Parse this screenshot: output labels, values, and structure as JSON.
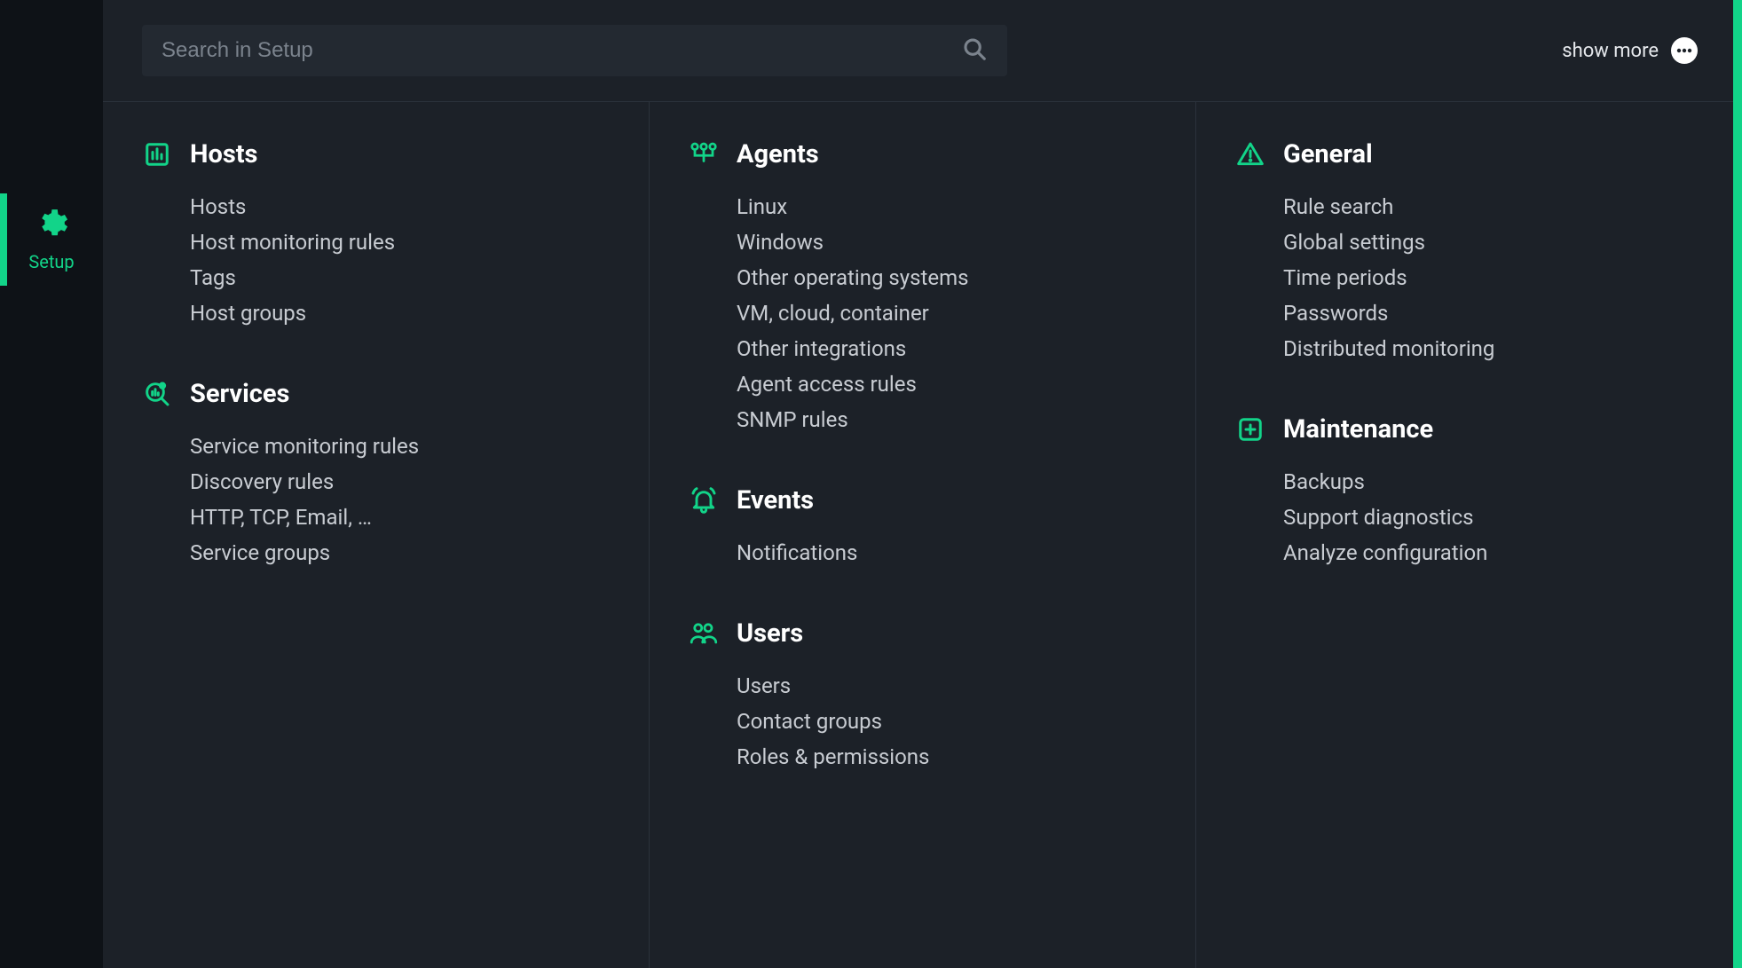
{
  "sidebar": {
    "active_label": "Setup"
  },
  "search": {
    "placeholder": "Search in Setup"
  },
  "show_more_label": "show more",
  "columns": [
    {
      "sections": [
        {
          "icon": "chart-box",
          "title": "Hosts",
          "items": [
            "Hosts",
            "Host monitoring rules",
            "Tags",
            "Host groups"
          ]
        },
        {
          "icon": "magnify-chart",
          "title": "Services",
          "items": [
            "Service monitoring rules",
            "Discovery rules",
            "HTTP, TCP, Email, …",
            "Service groups"
          ]
        }
      ]
    },
    {
      "sections": [
        {
          "icon": "network",
          "title": "Agents",
          "items": [
            "Linux",
            "Windows",
            "Other operating systems",
            "VM, cloud, container",
            "Other integrations",
            "Agent access rules",
            "SNMP rules"
          ]
        },
        {
          "icon": "bell",
          "title": "Events",
          "items": [
            "Notifications"
          ]
        },
        {
          "icon": "users",
          "title": "Users",
          "items": [
            "Users",
            "Contact groups",
            "Roles & permissions"
          ]
        }
      ]
    },
    {
      "sections": [
        {
          "icon": "warning",
          "title": "General",
          "items": [
            "Rule search",
            "Global settings",
            "Time periods",
            "Passwords",
            "Distributed monitoring"
          ]
        },
        {
          "icon": "plus-box",
          "title": "Maintenance",
          "items": [
            "Backups",
            "Support diagnostics",
            "Analyze configuration"
          ]
        }
      ]
    }
  ]
}
